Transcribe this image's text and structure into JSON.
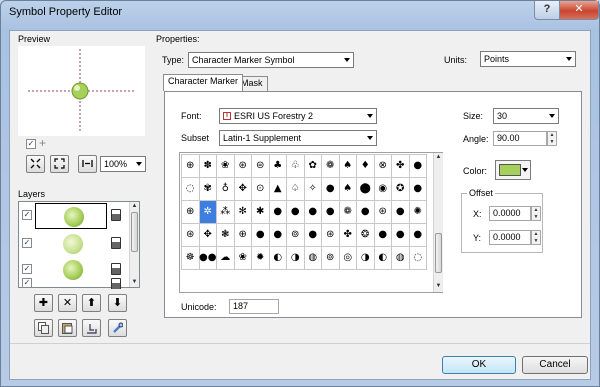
{
  "window": {
    "title": "Symbol Property Editor",
    "help_label": "?",
    "close_label": "✕"
  },
  "preview": {
    "label": "Preview",
    "zoom_value": "100%",
    "plus_icon_label": "+"
  },
  "layers": {
    "label": "Layers",
    "rows": [
      {
        "checked": "✓"
      },
      {
        "checked": "✓"
      },
      {
        "checked": "✓"
      },
      {
        "checked": "✓"
      }
    ],
    "tool_buttons": [
      "✚",
      "✕",
      "⬆",
      "⬇"
    ]
  },
  "properties": {
    "label": "Properties:",
    "type_label": "Type:",
    "type_value": "Character Marker Symbol",
    "units_label": "Units:",
    "units_value": "Points"
  },
  "tabs": [
    {
      "label": "Character Marker",
      "active": true
    },
    {
      "label": "Mask",
      "active": false
    }
  ],
  "character_marker": {
    "font_label": "Font:",
    "font_value": "ESRI US Forestry 2",
    "font_icon": "truetype-icon",
    "subset_label": "Subset",
    "subset_value": "Latin-1 Supplement",
    "size_label": "Size:",
    "size_value": "30",
    "angle_label": "Angle:",
    "angle_value": "90.00",
    "color_label": "Color:",
    "color_hex": "#a6d05c",
    "offset_label": "Offset",
    "x_label": "X:",
    "x_value": "0.0000",
    "y_label": "Y:",
    "y_value": "0.0000",
    "unicode_label": "Unicode:",
    "unicode_value": "187",
    "glyph_rows": [
      [
        "⊕",
        "✽",
        "❀",
        "⊛",
        "⊜",
        "♣",
        "♧",
        "✿",
        "❁",
        "♠",
        "♦",
        "⊗",
        "✤",
        "●"
      ],
      [
        "◌",
        "✾",
        "♁",
        "✥",
        "⊙",
        "▲",
        "♤",
        "✧",
        "●",
        "♠",
        "⬤",
        "◉",
        "✪",
        "●"
      ],
      [
        "⊕",
        "✲",
        "⁂",
        "✻",
        "✱",
        "●",
        "●",
        "●",
        "●",
        "❁",
        "●",
        "⊛",
        "●",
        "✺"
      ],
      [
        "⊛",
        "✥",
        "❃",
        "⊕",
        "●",
        "●",
        "⊚",
        "●",
        "⊛",
        "✤",
        "❂",
        "●",
        "●",
        "●"
      ],
      [
        "☸",
        "●●",
        "☁",
        "❀",
        "✹",
        "◐",
        "◑",
        "◍",
        "⊚",
        "◎",
        "◑",
        "◐",
        "◍",
        "◌"
      ]
    ],
    "selected_cell": [
      2,
      1
    ]
  },
  "footer": {
    "ok_label": "OK",
    "cancel_label": "Cancel"
  }
}
